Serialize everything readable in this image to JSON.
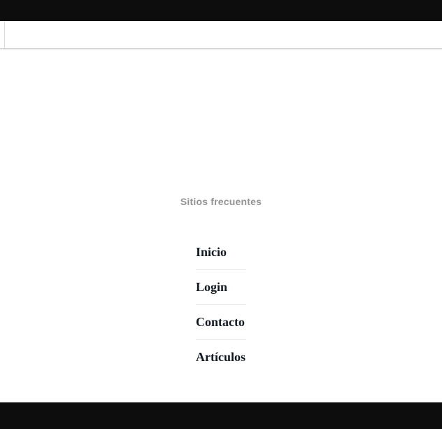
{
  "sectionTitle": "Sitios frecuentes",
  "links": [
    {
      "label": "Inicio"
    },
    {
      "label": "Login"
    },
    {
      "label": "Contacto"
    },
    {
      "label": "Artículos"
    }
  ]
}
